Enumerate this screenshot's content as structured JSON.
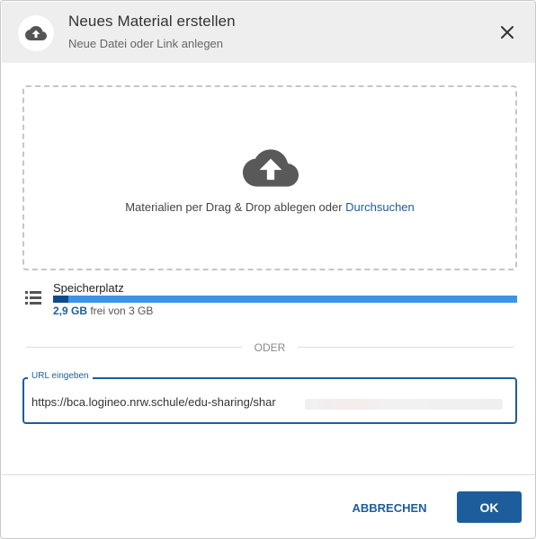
{
  "header": {
    "title": "Neues Material erstellen",
    "subtitle": "Neue Datei oder Link anlegen",
    "icon": "cloud-upload-icon",
    "close_icon": "close-icon"
  },
  "dropzone": {
    "icon": "cloud-upload-icon",
    "text": "Materialien per Drag & Drop ablegen oder ",
    "link": "Durchsuchen"
  },
  "storage": {
    "icon": "storage-icon",
    "label": "Speicherplatz",
    "free": "2,9 GB",
    "rest": " frei von 3 GB",
    "used_fraction": 0.033
  },
  "divider": {
    "text": "ODER"
  },
  "url": {
    "legend": "URL eingeben",
    "value": "https://bca.logineo.nrw.schule/edu-sharing/shar"
  },
  "footer": {
    "cancel_label": "ABBRECHEN",
    "ok_label": "OK"
  },
  "colors": {
    "accent": "#1d5d9b",
    "bar_free": "#3d93e8",
    "bar_used": "#114a8c",
    "header_bg": "#eeeeee"
  }
}
